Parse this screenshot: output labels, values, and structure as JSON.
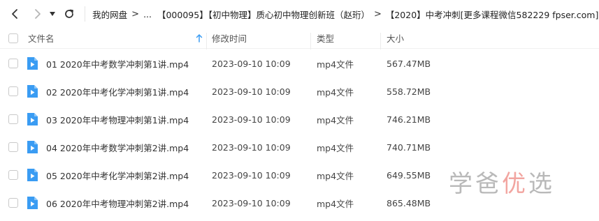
{
  "toolbar": {
    "back_icon": "chevron-left-icon",
    "forward_icon": "chevron-right-icon",
    "dropdown_icon": "caret-down-icon",
    "refresh_icon": "refresh-icon"
  },
  "breadcrumb": {
    "items": [
      "我的网盘",
      "...",
      "【000095】【初中物理】质心初中物理创新班（赵珩）",
      "【2020】中考冲刺[更多课程微信582229 fpser.com]"
    ],
    "separator": ">"
  },
  "columns": {
    "name": "文件名",
    "modified": "修改时间",
    "type": "类型",
    "size": "大小"
  },
  "files": [
    {
      "name": "01 2020年中考数学冲刺第1讲.mp4",
      "modified": "2023-09-10 10:09",
      "type": "mp4文件",
      "size": "567.47MB"
    },
    {
      "name": "02 2020年中考化学冲刺第1讲.mp4",
      "modified": "2023-09-10 10:09",
      "type": "mp4文件",
      "size": "558.72MB"
    },
    {
      "name": "03 2020年中考物理冲刺第1讲.mp4",
      "modified": "2023-09-10 10:09",
      "type": "mp4文件",
      "size": "746.21MB"
    },
    {
      "name": "04 2020年中考数学冲刺第2讲.mp4",
      "modified": "2023-09-10 10:09",
      "type": "mp4文件",
      "size": "740.71MB"
    },
    {
      "name": "05 2020年中考化学冲刺第2讲.mp4",
      "modified": "2023-09-10 10:09",
      "type": "mp4文件",
      "size": "649.55MB"
    },
    {
      "name": "06 2020年中考物理冲刺第2讲.mp4",
      "modified": "2023-09-10 10:09",
      "type": "mp4文件",
      "size": "865.48MB"
    }
  ],
  "watermark": {
    "part1": "学爸",
    "part2": "优",
    "part3": "选"
  },
  "colors": {
    "file_icon": "#3a9cf3",
    "watermark_gray": "#b9b9b9",
    "watermark_red": "#f2a5a0",
    "sort_arrow": "#3a9cf3"
  }
}
